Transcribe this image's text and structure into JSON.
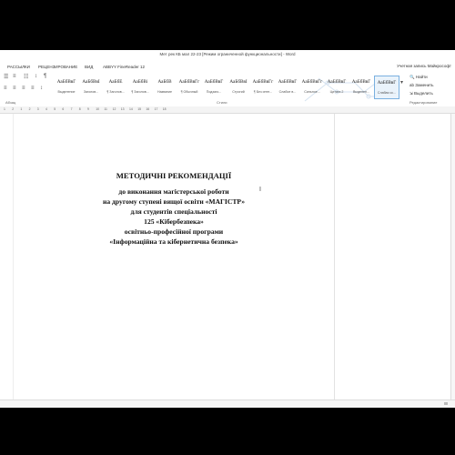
{
  "window": {
    "title": "Мет рек КБ мал 22-23 [Режим ограниченной функциональности] - Word"
  },
  "menu": {
    "items": [
      "РАССЫЛКИ",
      "РЕЦЕНЗИРОВАНИЕ",
      "ВИД",
      "ABBYY FineReader 12"
    ],
    "user": "Учетная запись Майкрософт"
  },
  "ribbon": {
    "paragraph_label": "Абзац",
    "styles_label": "Стили",
    "styles": [
      {
        "preview": "АаБбВвГ",
        "label": "Выделение"
      },
      {
        "preview": "АаБбВвІ",
        "label": "Заголов..."
      },
      {
        "preview": "АаБбЕ",
        "label": "¶ Заголов..."
      },
      {
        "preview": "АаБбВі",
        "label": "¶ Заголов..."
      },
      {
        "preview": "АаБбВ",
        "label": "Название"
      },
      {
        "preview": "АаБбВвГг",
        "label": "¶ Обычный"
      },
      {
        "preview": "АаБбВвГ",
        "label": "Подзаго..."
      },
      {
        "preview": "АаБбВвІ",
        "label": "Строгий"
      },
      {
        "preview": "АаБбВвГг",
        "label": "¶ Без инте..."
      },
      {
        "preview": "АаБбВвГ",
        "label": "Слабое в..."
      },
      {
        "preview": "АаБбВвГг",
        "label": "Сильное..."
      },
      {
        "preview": "АаБбВвГ",
        "label": "Цитата 2"
      },
      {
        "preview": "АаБбВвГ",
        "label": "Выделен..."
      },
      {
        "preview": "АаБбВвГ",
        "label": "Слабая сс..."
      }
    ],
    "editing": {
      "find": "Найти",
      "replace": "Заменить",
      "select": "Выделить",
      "label": "Редактирование"
    }
  },
  "ruler": {
    "numbers": [
      "1",
      "2",
      "1",
      "2",
      "3",
      "4",
      "5",
      "6",
      "7",
      "8",
      "9",
      "10",
      "11",
      "12",
      "13",
      "14",
      "15",
      "16",
      "17",
      "18"
    ]
  },
  "document": {
    "lines": [
      "МЕТОДИЧНІ РЕКОМЕНДАЦІЇ",
      "до виконання магістерської роботи",
      "на другому ступені вищої освіти «МАГІСТР»",
      "для студентів спеціальності",
      "125 «Кібербезпека»",
      "освітньо-професійної програми",
      "«Інформаційна та кібернетична безпека»"
    ]
  }
}
